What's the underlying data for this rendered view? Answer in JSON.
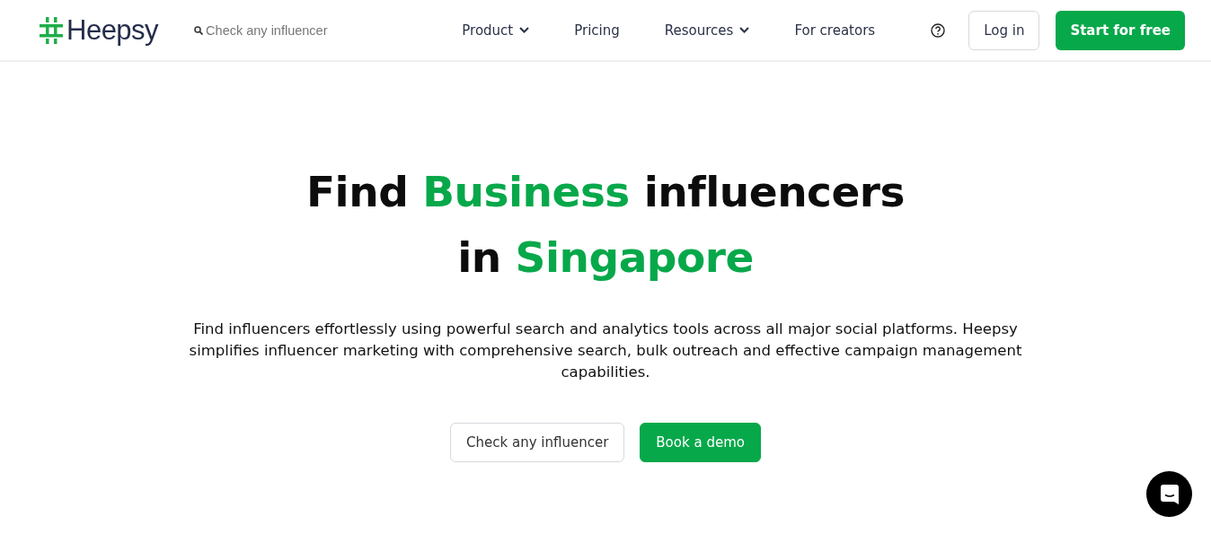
{
  "header": {
    "logo": "Heepsy",
    "search": {
      "placeholder": "Check any influencer"
    },
    "nav": [
      {
        "label": "Product",
        "dropdown": true
      },
      {
        "label": "Pricing",
        "dropdown": false
      },
      {
        "label": "Resources",
        "dropdown": true
      },
      {
        "label": "For creators",
        "dropdown": false
      }
    ],
    "login": "Log in",
    "cta": "Start for free"
  },
  "hero": {
    "heading_lines": [
      [
        {
          "text": "Find ",
          "highlight": false
        },
        {
          "text": "Business",
          "highlight": true
        },
        {
          "text": " influencers",
          "highlight": false
        }
      ],
      [
        {
          "text": "in ",
          "highlight": false
        },
        {
          "text": "Singapore",
          "highlight": true
        }
      ]
    ],
    "description": "Find influencers effortlessly using powerful search and analytics tools across all major social platforms. Heepsy simplifies influencer marketing with comprehensive search, bulk outreach and effective campaign management capabilities.",
    "buttons": [
      {
        "label": "Check any influencer",
        "kind": "outline"
      },
      {
        "label": "Book a demo",
        "kind": "primary"
      }
    ]
  }
}
